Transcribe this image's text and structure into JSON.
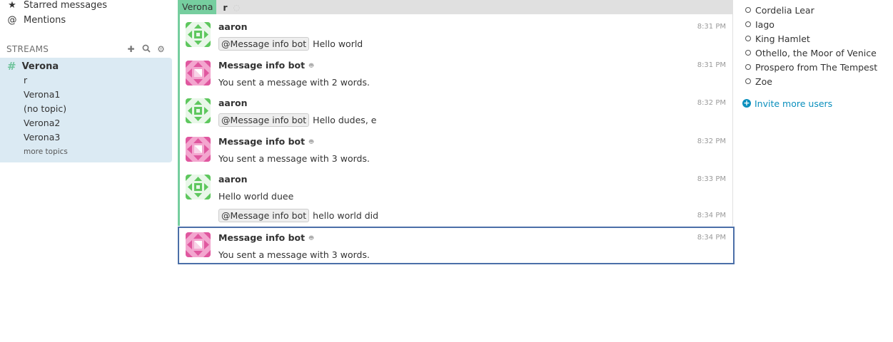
{
  "left_sidebar": {
    "nav": [
      {
        "label": "Starred messages",
        "icon": "star-icon",
        "glyph": "★"
      },
      {
        "label": "Mentions",
        "icon": "at-icon",
        "glyph": "@"
      }
    ],
    "streams_header": "STREAMS",
    "stream": {
      "name": "Verona",
      "glyph": "#"
    },
    "topics": [
      "r",
      "Verona1",
      "(no topic)",
      "Verona2",
      "Verona3"
    ],
    "more_topics": "more topics"
  },
  "feed": {
    "recipient": {
      "stream": "Verona",
      "topic": "r"
    },
    "messages": [
      {
        "sender": "aaron",
        "time": "8:31 PM",
        "mention": "@Message info bot",
        "text": "Hello world",
        "bot": false
      },
      {
        "sender": "Message info bot",
        "time": "8:31 PM",
        "mention": "",
        "text": "You sent a message with 2 words.",
        "bot": true
      },
      {
        "sender": "aaron",
        "time": "8:32 PM",
        "mention": "@Message info bot",
        "text": "Hello dudes, e",
        "bot": false
      },
      {
        "sender": "Message info bot",
        "time": "8:32 PM",
        "mention": "",
        "text": "You sent a message with 3 words.",
        "bot": true
      },
      {
        "sender": "aaron",
        "time": "8:33 PM",
        "mention": "",
        "text": "Hello world duee",
        "bot": false
      },
      {
        "sender": "",
        "time": "8:34 PM",
        "mention": "@Message info bot",
        "text": "hello world did",
        "bot": false
      },
      {
        "sender": "Message info bot",
        "time": "8:34 PM",
        "mention": "",
        "text": "You sent a message with 3 words.",
        "bot": true
      }
    ]
  },
  "right_sidebar": {
    "users": [
      "Cordelia Lear",
      "Iago",
      "King Hamlet",
      "Othello, the Moor of Venice",
      "Prospero from The Tempest",
      "Zoe"
    ],
    "invite": "Invite more users"
  },
  "colors": {
    "stream": "#76ce9f",
    "link": "#0a8fbd",
    "selected_border": "#4b6fa8"
  }
}
